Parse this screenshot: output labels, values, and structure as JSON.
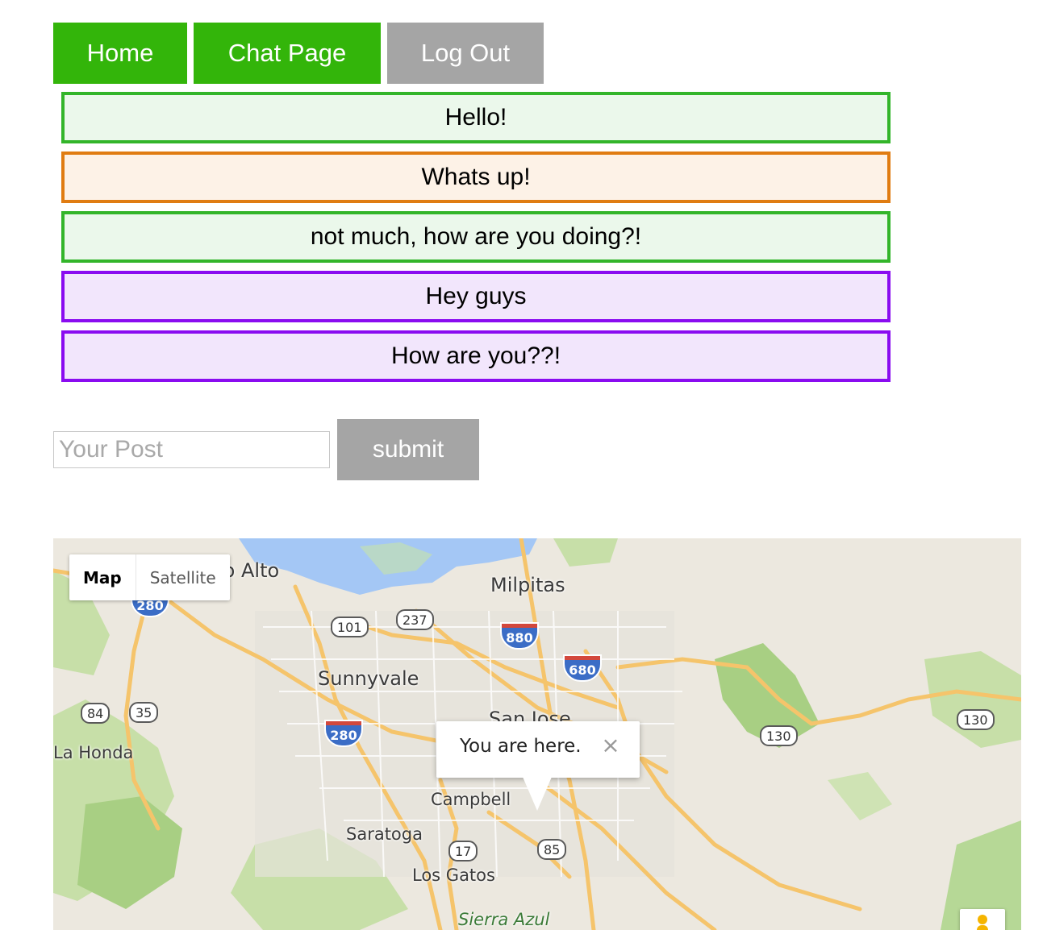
{
  "nav": {
    "home": "Home",
    "chat": "Chat Page",
    "logout": "Log Out"
  },
  "messages": [
    {
      "text": "Hello!",
      "color": "#33b52a"
    },
    {
      "text": "Whats up!",
      "color": "#e07c12"
    },
    {
      "text": "not much, how are you doing?!",
      "color": "#33b52a"
    },
    {
      "text": "Hey guys",
      "color": "#8a0cf0"
    },
    {
      "text": "How are you??!",
      "color": "#8a0cf0"
    }
  ],
  "post": {
    "placeholder": "Your Post",
    "submit": "submit"
  },
  "map": {
    "type_controls": {
      "map": "Map",
      "satellite": "Satellite"
    },
    "places": {
      "palo_alto": "lo Alto",
      "milpitas": "Milpitas",
      "sunnyvale": "Sunnyvale",
      "la_honda": "La Honda",
      "campbell": "Campbell",
      "saratoga": "Saratoga",
      "los_gatos": "Los Gatos",
      "sierra_azul": "Sierra Azul",
      "san_jose": "San Jose"
    },
    "shields": {
      "us101": "101",
      "r237": "237",
      "r84": "84",
      "r35": "35",
      "r130a": "130",
      "r130b": "130",
      "r17": "17",
      "r85": "85"
    },
    "interstates": {
      "i280a": "280",
      "i880": "880",
      "i680": "680",
      "i280b": "280"
    },
    "info_window": {
      "text": "You are here.",
      "close_icon": "close-icon"
    },
    "pegman_icon": "pegman-icon"
  }
}
